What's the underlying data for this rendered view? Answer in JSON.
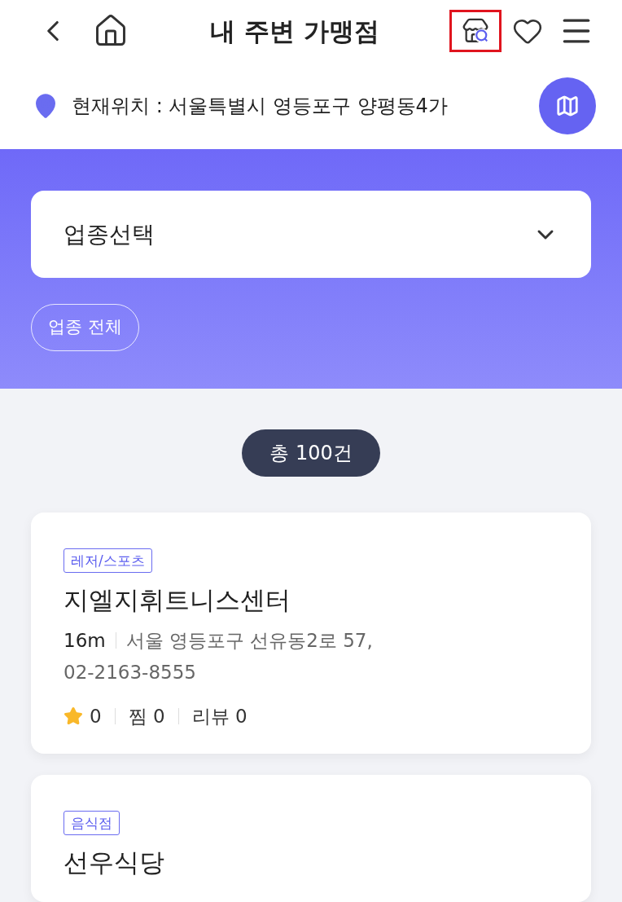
{
  "header": {
    "title": "내 주변 가맹점",
    "actions": [
      {
        "kind": "store-search",
        "highlighted": true
      },
      {
        "kind": "heart",
        "highlighted": false
      },
      {
        "kind": "menu",
        "highlighted": false
      }
    ]
  },
  "location": {
    "label": "현재위치 : 서울특별시 영등포구 양평동4가"
  },
  "filter": {
    "select_placeholder": "업종선택",
    "chips": [
      {
        "label": "업종 전체",
        "selected": false
      }
    ]
  },
  "total": "총 100건",
  "stores": [
    {
      "category": "레저/스포츠",
      "name": "지엘지휘트니스센터",
      "distance": "16m",
      "address": "서울 영등포구 선유동2로 57,",
      "phone": "02-2163-8555",
      "rating": "0",
      "likes": "찜 0",
      "reviews": "리뷰 0"
    },
    {
      "category": "음식점",
      "name": "선우식당"
    }
  ]
}
